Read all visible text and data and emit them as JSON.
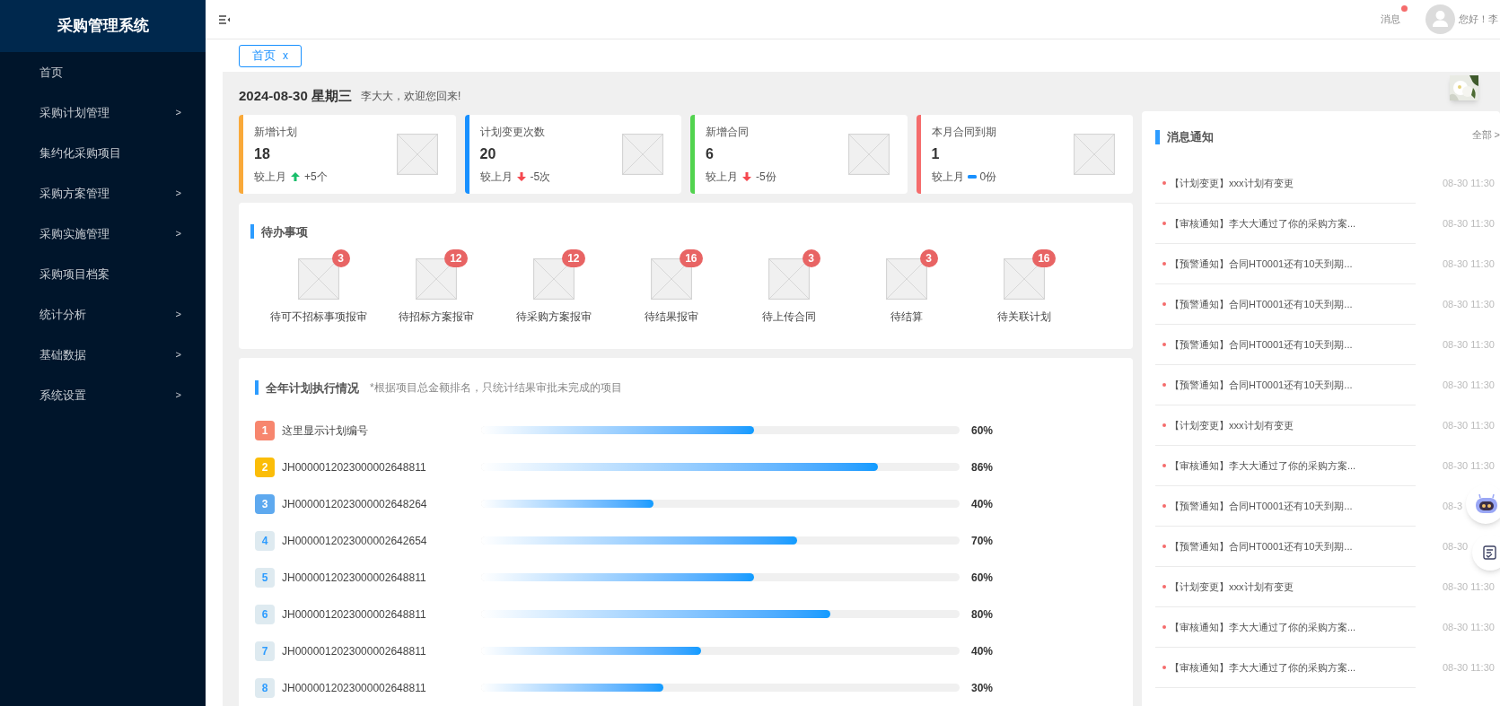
{
  "sidebar": {
    "title": "采购管理系统",
    "items": [
      {
        "label": "首页"
      },
      {
        "label": "采购计划管理",
        "arrow": ">"
      },
      {
        "label": "集约化采购项目"
      },
      {
        "label": "采购方案管理",
        "arrow": ">"
      },
      {
        "label": "采购实施管理",
        "arrow": ">"
      },
      {
        "label": "采购项目档案"
      },
      {
        "label": "统计分析",
        "arrow": ">"
      },
      {
        "label": "基础数据",
        "arrow": ">"
      },
      {
        "label": "系统设置",
        "arrow": ">"
      }
    ]
  },
  "header": {
    "messages": "消息",
    "unread": true,
    "greeting": "您好！李"
  },
  "tabs": [
    {
      "label": "首页",
      "close": "x",
      "selected": true
    }
  ],
  "welcome": {
    "date": "2024-08-30 星期三",
    "text": "李大大，欢迎您回来!"
  },
  "stats": [
    {
      "label": "新增计划",
      "value": "18",
      "compare": "较上月",
      "kind": "up",
      "delta": "+5个",
      "color": "#f9a93a"
    },
    {
      "label": "计划变更次数",
      "value": "20",
      "compare": "较上月",
      "kind": "down",
      "delta": "-5次",
      "color": "#1890ff"
    },
    {
      "label": "新增合同",
      "value": "6",
      "compare": "较上月",
      "kind": "down",
      "delta": "-5份",
      "color": "#52d34f"
    },
    {
      "label": "本月合同到期",
      "value": "1",
      "compare": "较上月",
      "kind": "flat",
      "delta": "0份",
      "color": "#f56c6c"
    }
  ],
  "todo": {
    "title": "待办事项",
    "items": [
      {
        "label": "待可不招标事项报审",
        "count": "3"
      },
      {
        "label": "待招标方案报审",
        "count": "12"
      },
      {
        "label": "待采购方案报审",
        "count": "12"
      },
      {
        "label": "待结果报审",
        "count": "16"
      },
      {
        "label": "待上传合同",
        "count": "3"
      },
      {
        "label": "待结算",
        "count": "3"
      },
      {
        "label": "待关联计划",
        "count": "16"
      }
    ]
  },
  "plan": {
    "title": "全年计划执行情况",
    "note": "*根据项目总金额排名，只统计结果审批未完成的项目",
    "rows": [
      {
        "rank": "1",
        "kind": "top",
        "color": "#f7866e",
        "name": "这里显示计划编号",
        "level": 0.57,
        "percent": "60%"
      },
      {
        "rank": "2",
        "kind": "top",
        "color": "#fbbd08",
        "name": "JH0000012023000002648811",
        "level": 0.83,
        "percent": "86%"
      },
      {
        "rank": "3",
        "kind": "top",
        "color": "#5ea9ef",
        "name": "JH0000012023000002648264",
        "level": 0.36,
        "percent": "40%"
      },
      {
        "rank": "4",
        "kind": "normal",
        "color": "#deeaf0",
        "name": "JH0000012023000002642654",
        "level": 0.66,
        "percent": "70%"
      },
      {
        "rank": "5",
        "kind": "normal",
        "color": "#deeaf0",
        "name": "JH0000012023000002648811",
        "level": 0.57,
        "percent": "60%"
      },
      {
        "rank": "6",
        "kind": "normal",
        "color": "#deeaf0",
        "name": "JH0000012023000002648811",
        "level": 0.73,
        "percent": "80%"
      },
      {
        "rank": "7",
        "kind": "normal",
        "color": "#deeaf0",
        "name": "JH0000012023000002648811",
        "level": 0.46,
        "percent": "40%"
      },
      {
        "rank": "8",
        "kind": "normal",
        "color": "#deeaf0",
        "name": "JH0000012023000002648811",
        "level": 0.38,
        "percent": "30%"
      }
    ]
  },
  "notices": {
    "title": "消息通知",
    "more": "全部 >",
    "items": [
      {
        "text": "【计划变更】xxx计划有变更",
        "time": "08-30 11:30"
      },
      {
        "text": "【审核通知】李大大通过了你的采购方案...",
        "time": "08-30 11:30"
      },
      {
        "text": "【预警通知】合同HT0001还有10天到期...",
        "time": "08-30 11:30"
      },
      {
        "text": "【预警通知】合同HT0001还有10天到期...",
        "time": "08-30 11:30"
      },
      {
        "text": "【预警通知】合同HT0001还有10天到期...",
        "time": "08-30 11:30"
      },
      {
        "text": "【预警通知】合同HT0001还有10天到期...",
        "time": "08-30 11:30"
      },
      {
        "text": "【计划变更】xxx计划有变更",
        "time": "08-30 11:30"
      },
      {
        "text": "【审核通知】李大大通过了你的采购方案...",
        "time": "08-30 11:30"
      },
      {
        "text": "【预警通知】合同HT0001还有10天到期...",
        "time": "08-3"
      },
      {
        "text": "【预警通知】合同HT0001还有10天到期...",
        "time": "08-30"
      },
      {
        "text": "【计划变更】xxx计划有变更",
        "time": "08-30 11:30"
      },
      {
        "text": "【审核通知】李大大通过了你的采购方案...",
        "time": "08-30 11:30"
      },
      {
        "text": "【审核通知】李大大通过了你的采购方案...",
        "time": "08-30 11:30"
      }
    ]
  }
}
